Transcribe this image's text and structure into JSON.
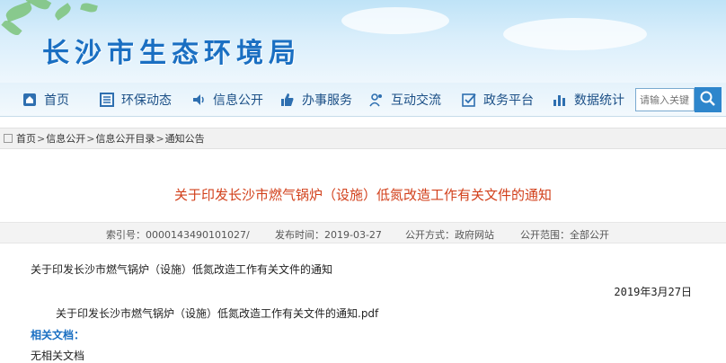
{
  "header": {
    "site_title": "长沙市生态环境局"
  },
  "nav": {
    "items": [
      {
        "label": "首页",
        "icon": "home-icon"
      },
      {
        "label": "环保动态",
        "icon": "news-icon"
      },
      {
        "label": "信息公开",
        "icon": "broadcast-icon"
      },
      {
        "label": "办事服务",
        "icon": "thumbs-up-icon"
      },
      {
        "label": "互动交流",
        "icon": "users-icon"
      },
      {
        "label": "政务平台",
        "icon": "checkbox-icon"
      },
      {
        "label": "数据统计",
        "icon": "bar-chart-icon"
      }
    ],
    "search_placeholder": "请输入关键",
    "search_icon": "search-icon"
  },
  "breadcrumb": {
    "items": [
      "首页",
      "信息公开",
      "信息公开目录",
      "通知公告"
    ],
    "separator": ">"
  },
  "article": {
    "title": "关于印发长沙市燃气锅炉（设施）低氮改造工作有关文件的通知",
    "meta": {
      "index": "索引号：0000143490101027/",
      "publish_time": "发布时间：2019-03-27",
      "publish_method": "公开方式：政府网站",
      "scope": "公开范围：全部公开"
    },
    "body_heading": "关于印发长沙市燃气锅炉（设施）低氮改造工作有关文件的通知",
    "date": "2019年3月27日",
    "attachment": "关于印发长沙市燃气锅炉（设施）低氮改造工作有关文件的通知.pdf",
    "related_label": "相关文档：",
    "related_none": "无相关文档"
  },
  "colors": {
    "title_red": "#d2401b",
    "brand_blue": "#1a6fc2",
    "nav_text": "#1b4f86"
  }
}
